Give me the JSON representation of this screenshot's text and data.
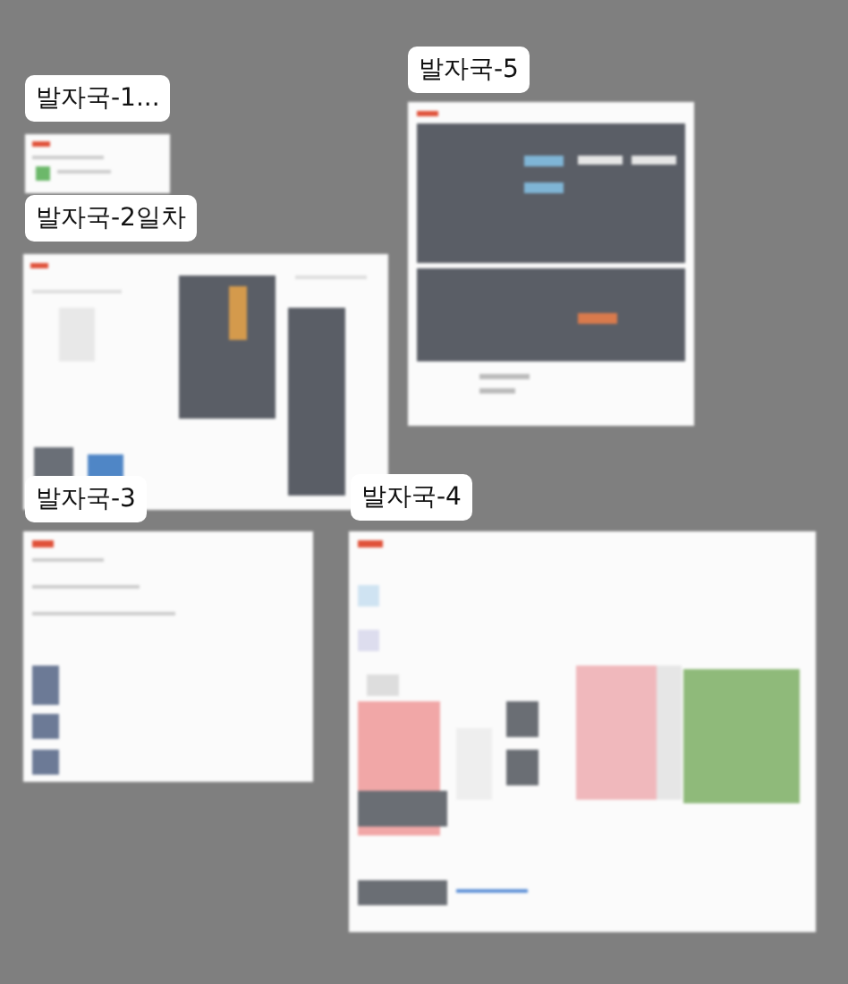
{
  "frames": [
    {
      "label": "발자국-1...",
      "kind": "picture"
    },
    {
      "label": "발자국-2일차",
      "kind": "picture"
    },
    {
      "label": "발자국-5",
      "kind": "picture"
    },
    {
      "label": "발자국-3",
      "kind": "picture"
    },
    {
      "label": "발자국-4",
      "kind": "picture"
    }
  ]
}
